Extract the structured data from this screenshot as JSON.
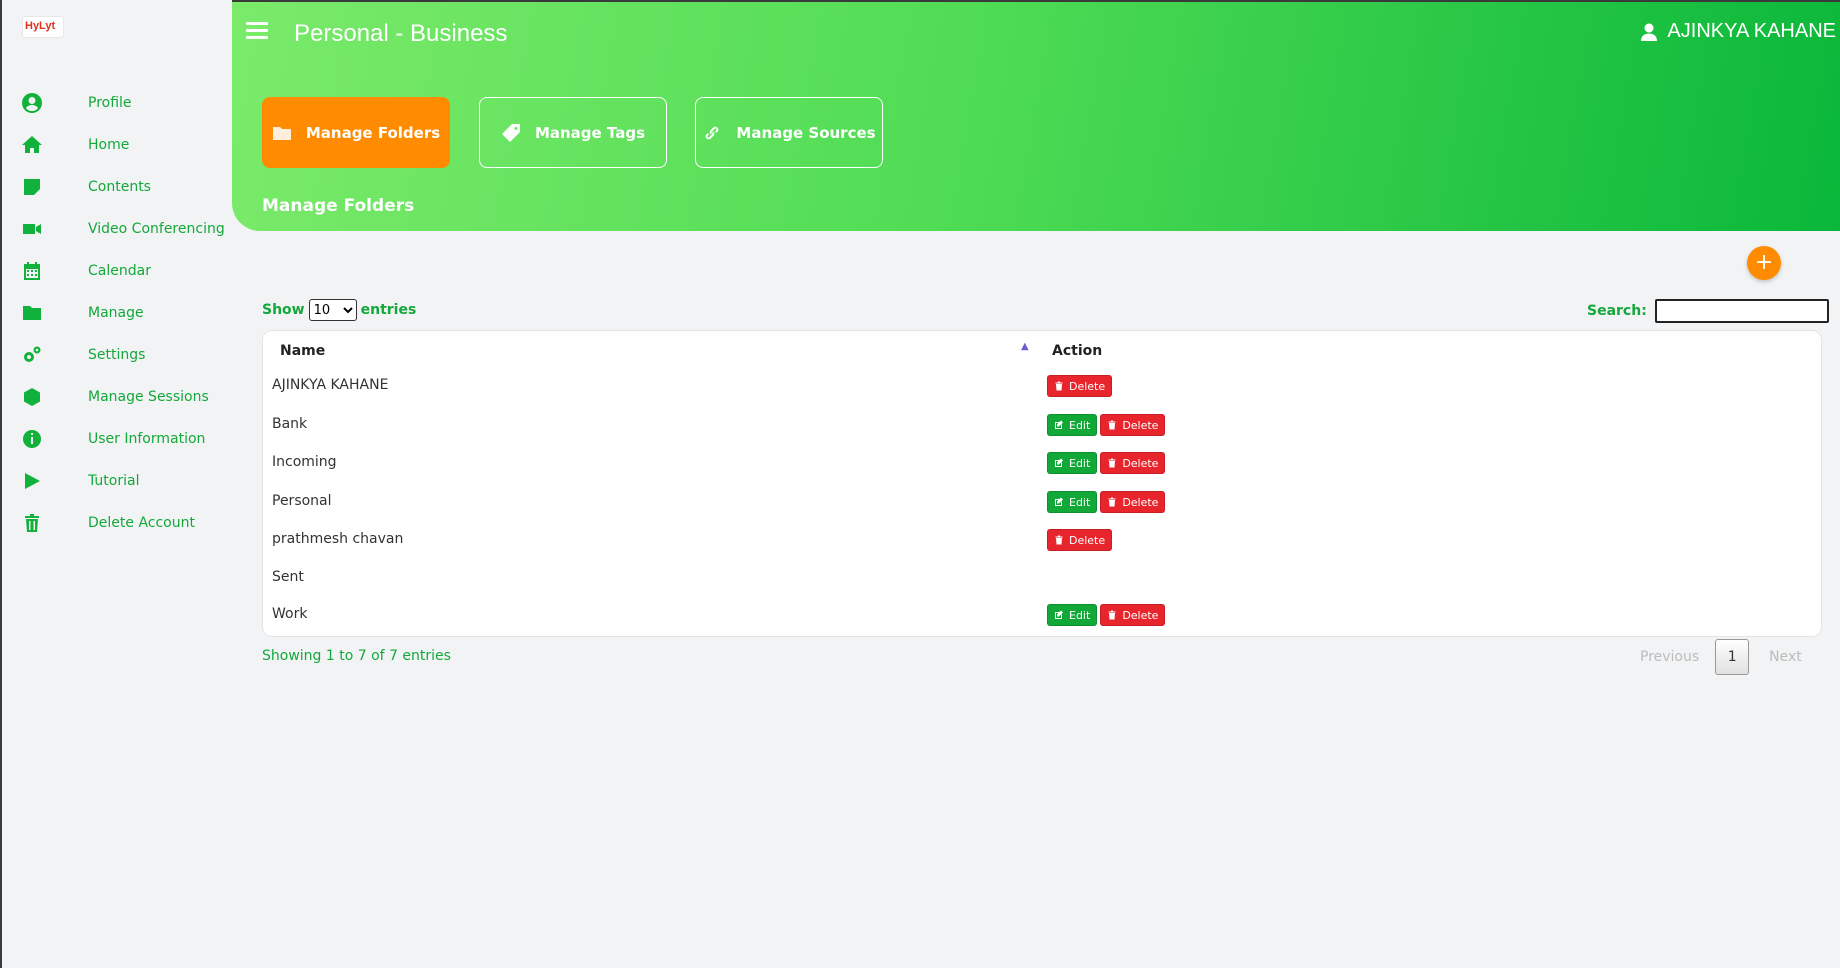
{
  "app": {
    "logo_text": "HyLyt"
  },
  "sidebar": {
    "items": [
      {
        "label": "Profile",
        "icon": "user-circle-icon"
      },
      {
        "label": "Home",
        "icon": "home-icon"
      },
      {
        "label": "Contents",
        "icon": "note-icon"
      },
      {
        "label": "Video Conferencing",
        "icon": "video-camera-icon"
      },
      {
        "label": "Calendar",
        "icon": "calendar-icon"
      },
      {
        "label": "Manage",
        "icon": "folder-icon"
      },
      {
        "label": "Settings",
        "icon": "gears-icon"
      },
      {
        "label": "Manage Sessions",
        "icon": "hexagon-icon"
      },
      {
        "label": "User Information",
        "icon": "info-circle-icon"
      },
      {
        "label": "Tutorial",
        "icon": "play-icon"
      },
      {
        "label": "Delete Account",
        "icon": "trash-icon"
      }
    ]
  },
  "header": {
    "title": "Personal - Business",
    "user_name": "AJINKYA KAHANE",
    "tabs": [
      {
        "label": "Manage Folders",
        "active": true
      },
      {
        "label": "Manage Tags",
        "active": false
      },
      {
        "label": "Manage Sources",
        "active": false
      }
    ],
    "section_title": "Manage Folders"
  },
  "add_button": {
    "label": "+"
  },
  "table_controls": {
    "show_label": "Show",
    "entries_label": "entries",
    "page_size": "10",
    "page_size_options": [
      "10"
    ],
    "search_label": "Search:",
    "search_value": ""
  },
  "table": {
    "columns": [
      "Name",
      "Action"
    ],
    "rows": [
      {
        "name": "AJINKYA KAHANE",
        "edit": false,
        "delete": true
      },
      {
        "name": "Bank",
        "edit": true,
        "delete": true
      },
      {
        "name": "Incoming",
        "edit": true,
        "delete": true
      },
      {
        "name": "Personal",
        "edit": true,
        "delete": true
      },
      {
        "name": "prathmesh chavan",
        "edit": false,
        "delete": true
      },
      {
        "name": "Sent",
        "edit": false,
        "delete": false
      },
      {
        "name": "Work",
        "edit": true,
        "delete": true
      }
    ],
    "edit_label": "Edit",
    "delete_label": "Delete"
  },
  "footer": {
    "info": "Showing 1 to 7 of 7 entries",
    "previous": "Previous",
    "page": "1",
    "next": "Next"
  },
  "colors": {
    "brand_green": "#11b23c",
    "accent_orange": "#ff8c00",
    "delete_red": "#e8242c"
  }
}
